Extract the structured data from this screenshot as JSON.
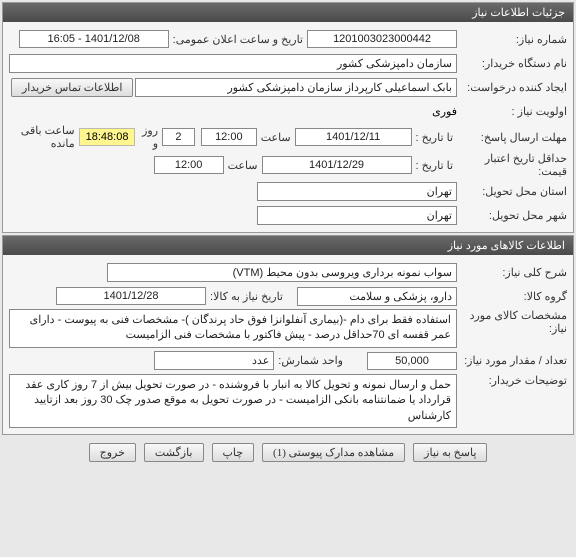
{
  "panel1": {
    "title": "جزئیات اطلاعات نیاز",
    "need_no_label": "شماره نیاز:",
    "need_no": "1201003023000442",
    "announce_label": "تاریخ و ساعت اعلان عمومی:",
    "announce_value": "1401/12/08 - 16:05",
    "buyer_label": "نام دستگاه خریدار:",
    "buyer_value": "سازمان دامپزشکی کشور",
    "requester_label": "ایجاد کننده درخواست:",
    "requester_value": "بابک اسماعیلی کارپرداز سازمان دامپزشکی کشور",
    "contact_btn": "اطلاعات تماس خریدار",
    "priority_label": "اولویت نیاز :",
    "priority_value": "فوری",
    "deadline_label": "مهلت ارسال پاسخ:",
    "to_date_label": "تا تاریخ :",
    "deadline_date": "1401/12/11",
    "time_label": "ساعت",
    "deadline_time": "12:00",
    "days_remain": "2",
    "days_text": "روز و",
    "time_remain": "18:48:08",
    "remain_text": "ساعت باقی مانده",
    "min_valid_label": "حداقل تاریخ اعتبار قیمت:",
    "min_valid_date": "1401/12/29",
    "min_valid_time": "12:00",
    "province_label": "استان محل تحویل:",
    "province_value": "تهران",
    "city_label": "شهر محل تحویل:",
    "city_value": "تهران"
  },
  "panel2": {
    "title": "اطلاعات کالاهای مورد نیاز",
    "desc_label": "شرح کلی نیاز:",
    "desc_value": "سواب نمونه برداری ویروسی بدون محیط (VTM)",
    "group_label": "گروه کالا:",
    "group_value": "دارو، پزشکی و سلامت",
    "need_date_label": "تاریخ نیاز به کالا:",
    "need_date": "1401/12/28",
    "spec_label": "مشخصات کالای مورد نیاز:",
    "spec_value": "استفاده فقط برای دام -(بیماری آنفلوانزا فوق حاد پرندگان )- مشخصات فنی به پیوست -  دارای عمر قفسه ای 70حداقل درصد  - پیش فاکتور با مشخصات فنی الزامیست",
    "qty_label": "تعداد / مقدار مورد نیاز:",
    "qty_value": "50,000",
    "unit_label": "واحد شمارش:",
    "unit_value": "عدد",
    "buyer_notes_label": "توضیحات خریدار:",
    "buyer_notes_value": "حمل و ارسال نمونه   و تحویل کالا به انبار با فروشنده - در صورت تحویل بیش از 7 روز کاری عقد قرارداد یا ضمانتنامه بانکی الزامیست - در صورت تحویل به موقع صدور چک 30 روز بعد ازتایید کارشناس"
  },
  "buttons": {
    "reply": "پاسخ به نیاز",
    "attachments": "مشاهده مدارک پیوستی (1)",
    "print": "چاپ",
    "back": "بازگشت",
    "exit": "خروج"
  }
}
